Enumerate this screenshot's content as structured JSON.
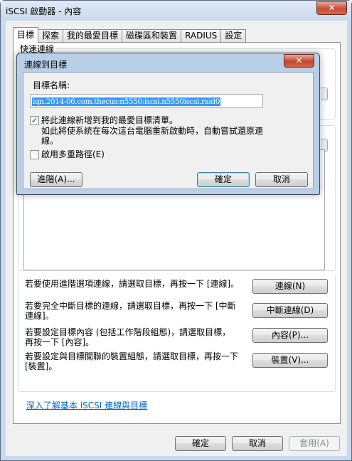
{
  "window": {
    "title": "iSCSI 啟動器 - 內容",
    "close_glyph": "✕"
  },
  "tabs": [
    {
      "label": "目標"
    },
    {
      "label": "探索"
    },
    {
      "label": "我的最愛目標"
    },
    {
      "label": "磁碟區和裝置"
    },
    {
      "label": "RADIUS"
    },
    {
      "label": "設定"
    }
  ],
  "quick_connect": {
    "label": "快速連線"
  },
  "instructions": {
    "connect": "若要使用進階選項連線，請選取目標，再按一下 [連線]。",
    "disconnect": "若要完全中斷目標的連線，請選取目標，再按一下 [中斷連線]。",
    "properties": "若要設定目標內容 (包括工作階段組態)，請選取目標，再按一下 [內容]。",
    "devices": "若要設定與目標關聯的裝置組態，請選取目標，再按一下 [裝置]。"
  },
  "buttons": {
    "connect": "連線(N)",
    "disconnect": "中斷連線(D)",
    "properties": "內容(P)...",
    "devices": "裝置(V)...",
    "ok": "確定",
    "cancel": "取消",
    "apply": "套用(A)"
  },
  "help_link": "深入了解基本 iSCSI 連線與目標",
  "dialog": {
    "title": "連線到目標",
    "close_glyph": "✕",
    "target_name_label": "目標名稱:",
    "target_name_value": "iqn.2014-06.com.thecus:n5550:iscsi.n5550iscsi.raid0",
    "add_favorite": {
      "checked": true,
      "label": "將此連線新增到我的最愛目標清單。",
      "note": "如此將使系統在每次這台電腦重新啟動時，自動嘗試還原連線。"
    },
    "multipath": {
      "checked": false,
      "label": "啟用多重路徑(E)"
    },
    "buttons": {
      "advanced": "進階(A)...",
      "ok": "確定",
      "cancel": "取消"
    }
  }
}
